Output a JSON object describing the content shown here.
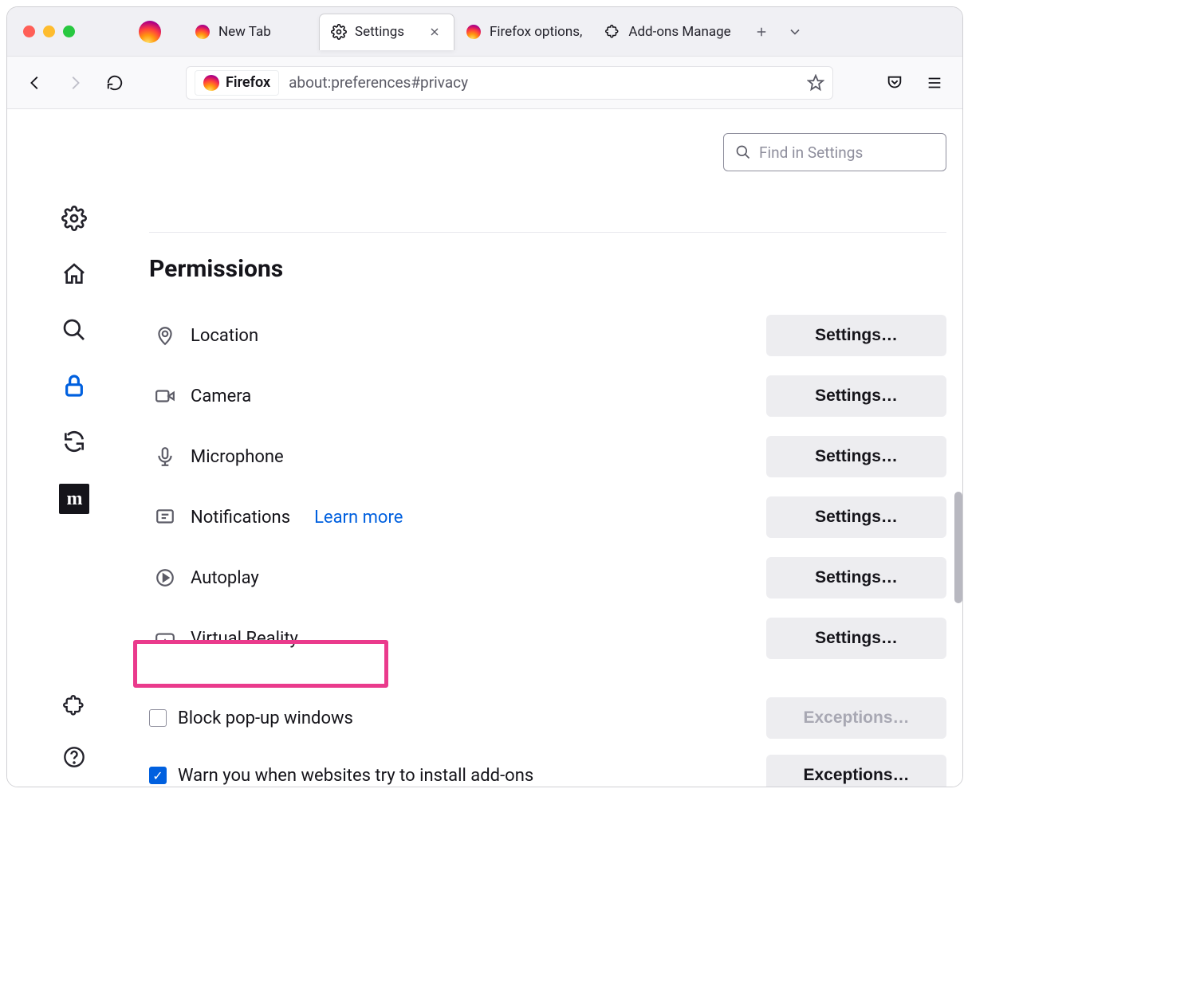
{
  "window": {
    "tabs": [
      {
        "label": "New Tab"
      },
      {
        "label": "Settings"
      },
      {
        "label": "Firefox options,"
      },
      {
        "label": "Add-ons Manage"
      }
    ]
  },
  "toolbar": {
    "identity_label": "Firefox",
    "url": "about:preferences#privacy"
  },
  "search": {
    "placeholder": "Find in Settings"
  },
  "permissions": {
    "title": "Permissions",
    "items": [
      {
        "icon": "location",
        "label": "Location",
        "button": "Settings…"
      },
      {
        "icon": "camera",
        "label": "Camera",
        "button": "Settings…"
      },
      {
        "icon": "microphone",
        "label": "Microphone",
        "button": "Settings…"
      },
      {
        "icon": "notifications",
        "label": "Notifications",
        "link": "Learn more",
        "button": "Settings…"
      },
      {
        "icon": "autoplay",
        "label": "Autoplay",
        "button": "Settings…"
      },
      {
        "icon": "vr",
        "label": "Virtual Reality",
        "button": "Settings…"
      }
    ],
    "block_popups": {
      "label": "Block pop-up windows",
      "checked": false,
      "button": "Exceptions…"
    },
    "warn_addons": {
      "label": "Warn you when websites try to install add-ons",
      "checked": true,
      "button": "Exceptions…"
    }
  },
  "sidebar": {
    "bottom_ext": "Extensions",
    "bottom_help": "Help"
  }
}
